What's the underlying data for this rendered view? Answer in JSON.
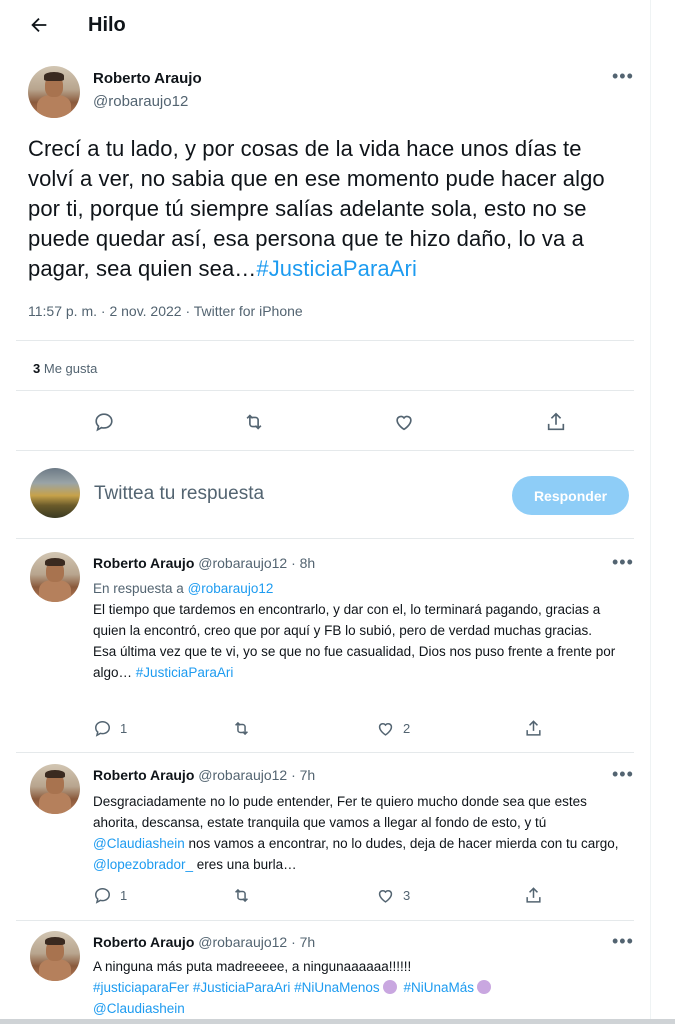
{
  "header": {
    "title": "Hilo"
  },
  "main_tweet": {
    "name": "Roberto Araujo",
    "handle": "@robaraujo12",
    "text": "Crecí a tu lado, y por cosas de la vida hace unos días te volví a ver, no sabia que en ese momento pude hacer algo por ti, porque tú siempre salías adelante sola, esto no se puede quedar así, esa persona que te hizo daño, lo va a pagar, sea quien sea…",
    "hashtag": "#JusticiaParaAri",
    "meta": "11:57 p. m. · 2 nov. 2022 · Twitter for iPhone",
    "likes_count": "3",
    "likes_label": "Me gusta"
  },
  "composer": {
    "placeholder": "Twittea tu respuesta",
    "button": "Responder"
  },
  "replies": [
    {
      "name": "Roberto Araujo",
      "handle": "@robaraujo12",
      "time": "· 8h",
      "reply_to_label": "En respuesta a",
      "reply_to": "@robaraujo12",
      "text": "El tiempo que tardemos en encontrarlo, y dar con el, lo terminará pagando, gracias a quien la encontró, creo que por aquí y FB lo subió, pero de verdad muchas gracias.",
      "text2": "Esa última vez que te vi, yo se que no fue casualidad, Dios nos puso frente a frente por algo…",
      "hashtag": "#JusticiaParaAri",
      "replies_count": "1",
      "retweets_count": "",
      "likes_count": "2"
    },
    {
      "name": "Roberto Araujo",
      "handle": "@robaraujo12",
      "time": "· 7h",
      "text_a": "Desgraciadamente no lo pude entender, Fer te quiero mucho donde sea que estes ahorita, descansa, estate tranquila que vamos a llegar al fondo de esto, y  tú",
      "mention_a": "@Claudiashein",
      "text_b": "nos vamos a encontrar, no lo dudes, deja de hacer mierda con tu cargo,",
      "mention_b": "@lopezobrador_",
      "text_c": "eres una burla…",
      "replies_count": "1",
      "retweets_count": "",
      "likes_count": "3"
    },
    {
      "name": "Roberto Araujo",
      "handle": "@robaraujo12",
      "time": "· 7h",
      "text": "A ninguna más puta madreeeee, a ningunaaaaaa!!!!!!",
      "tags": [
        "#justiciaparaFer",
        "#JusticiaParaAri",
        "#NiUnaMenos",
        "#NiUnaMás"
      ],
      "mention": "@Claudiashein"
    }
  ],
  "colors": {
    "accent": "#1d9bf0",
    "muted": "#536471",
    "button_disabled": "#8ecdf7"
  },
  "icons": [
    "back-arrow-icon",
    "more-icon",
    "reply-icon",
    "retweet-icon",
    "like-icon",
    "share-icon",
    "ribbon-emoji-icon"
  ]
}
